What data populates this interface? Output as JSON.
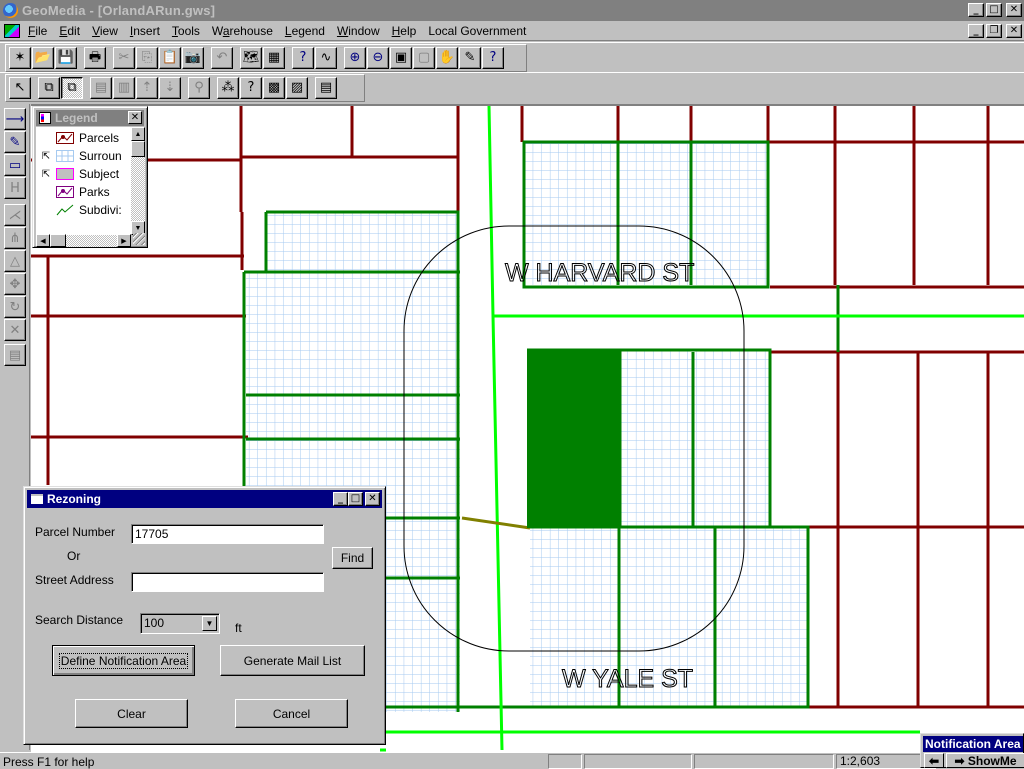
{
  "app": {
    "title": "GeoMedia - [OrlandARun.gws]"
  },
  "menu": {
    "items": [
      {
        "label": "File",
        "accel": "F"
      },
      {
        "label": "Edit",
        "accel": "E"
      },
      {
        "label": "View",
        "accel": "V"
      },
      {
        "label": "Insert",
        "accel": "I"
      },
      {
        "label": "Tools",
        "accel": "T"
      },
      {
        "label": "Warehouse",
        "accel": "a"
      },
      {
        "label": "Legend",
        "accel": "L"
      },
      {
        "label": "Window",
        "accel": "W"
      },
      {
        "label": "Help",
        "accel": "H"
      },
      {
        "label": "Local Government",
        "accel": ""
      }
    ]
  },
  "toolbar1": {
    "buttons": [
      {
        "name": "new-geoworkspace",
        "glyph": "✶"
      },
      {
        "name": "open-geoworkspace",
        "glyph": "📂"
      },
      {
        "name": "save-geoworkspace",
        "glyph": "💾"
      },
      {
        "name": "print",
        "glyph": "🖶"
      },
      {
        "name": "cut",
        "glyph": "✂",
        "disabled": true
      },
      {
        "name": "copy",
        "glyph": "⎘",
        "disabled": true
      },
      {
        "name": "paste",
        "glyph": "📋",
        "disabled": true
      },
      {
        "name": "copy-map-image",
        "glyph": "📷"
      },
      {
        "name": "undo",
        "glyph": "↶",
        "disabled": true
      },
      {
        "name": "new-map-window",
        "glyph": "🗺"
      },
      {
        "name": "new-data-window",
        "glyph": "▦"
      },
      {
        "name": "whats-this",
        "glyph": "?"
      },
      {
        "name": "select-tool",
        "glyph": "∿"
      },
      {
        "name": "zoom-in",
        "glyph": "⊕"
      },
      {
        "name": "zoom-out",
        "glyph": "⊖"
      },
      {
        "name": "fit-all",
        "glyph": "▣"
      },
      {
        "name": "fit-selected",
        "glyph": "▢",
        "disabled": true
      },
      {
        "name": "pan",
        "glyph": "✋"
      },
      {
        "name": "refresh",
        "glyph": "✎"
      },
      {
        "name": "help",
        "glyph": "?"
      }
    ]
  },
  "toolbar2": {
    "buttons": [
      {
        "name": "select",
        "glyph": "↖"
      },
      {
        "name": "select-set",
        "glyph": "⧉"
      },
      {
        "name": "select-set-pressed",
        "glyph": "⧉",
        "pressed": true
      },
      {
        "name": "data-window-1",
        "glyph": "▤",
        "disabled": true
      },
      {
        "name": "data-window-2",
        "glyph": "▥",
        "disabled": true
      },
      {
        "name": "move-up",
        "glyph": "⇡",
        "disabled": true
      },
      {
        "name": "move-down",
        "glyph": "⇣",
        "disabled": true
      },
      {
        "name": "attribute-query",
        "glyph": "⚲",
        "disabled": true
      },
      {
        "name": "insert-feature",
        "glyph": "⁂"
      },
      {
        "name": "insert-text",
        "glyph": "?"
      },
      {
        "name": "insert-area",
        "glyph": "▩"
      },
      {
        "name": "insert-point",
        "glyph": "▨"
      },
      {
        "name": "properties",
        "glyph": "▤"
      }
    ]
  },
  "vtoolbar": {
    "buttons": [
      {
        "name": "insert-line",
        "glyph": "⟶"
      },
      {
        "name": "edit-attribute",
        "glyph": "✎"
      },
      {
        "name": "insert-label",
        "glyph": "▭"
      },
      {
        "name": "hatch",
        "glyph": "H",
        "disabled": true
      },
      {
        "name": "digitize",
        "glyph": "⋌",
        "disabled": true
      },
      {
        "name": "split",
        "glyph": "⋔",
        "disabled": true
      },
      {
        "name": "continue-geometry",
        "glyph": "△",
        "disabled": true
      },
      {
        "name": "move",
        "glyph": "✥",
        "disabled": true
      },
      {
        "name": "rotate",
        "glyph": "↻",
        "disabled": true
      },
      {
        "name": "delete",
        "glyph": "✕",
        "disabled": true
      },
      {
        "name": "feature-properties",
        "glyph": "▤",
        "disabled": true
      }
    ]
  },
  "legend": {
    "title": "Legend",
    "entries": [
      {
        "label": "Parcels",
        "style": "line",
        "color": "#800000",
        "pointer": false
      },
      {
        "label": "Surroun",
        "style": "grid",
        "color": "#a6caf0",
        "pointer": true
      },
      {
        "label": "Subject",
        "style": "fill",
        "color": "#c0c0c0",
        "border": "#ff00ff",
        "pointer": true
      },
      {
        "label": "Parks",
        "style": "line",
        "color": "#800080",
        "pointer": false
      },
      {
        "label": "Subdivi:",
        "style": "polyline",
        "color": "#008000",
        "pointer": false
      }
    ]
  },
  "map": {
    "labels": [
      {
        "text": "W HARVARD ST"
      },
      {
        "text": "W YALE ST"
      }
    ],
    "colors": {
      "parcel": "#800000",
      "surrounding": "#008000",
      "surrounding_fill": "#a6caf0",
      "subject": "#008000",
      "road": "#00ff00",
      "connector": "#808000",
      "buffer": "#000000"
    }
  },
  "dialog": {
    "title": "Rezoning",
    "parcel_label": "Parcel Number",
    "parcel_value": "17705",
    "or_label": "Or",
    "street_label": "Street Address",
    "street_value": "",
    "find_button": "Find",
    "distance_label": "Search Distance",
    "distance_value": "100",
    "distance_unit": "ft",
    "define_button": "Define Notification Area",
    "generate_button": "Generate Mail List",
    "clear_button": "Clear",
    "cancel_button": "Cancel"
  },
  "statusbar": {
    "help": "Press F1 for help",
    "scale": "1:2,603"
  },
  "notification": {
    "title": "Notification Area",
    "back_button": "⬅",
    "showme_button": "➡ ShowMe"
  }
}
